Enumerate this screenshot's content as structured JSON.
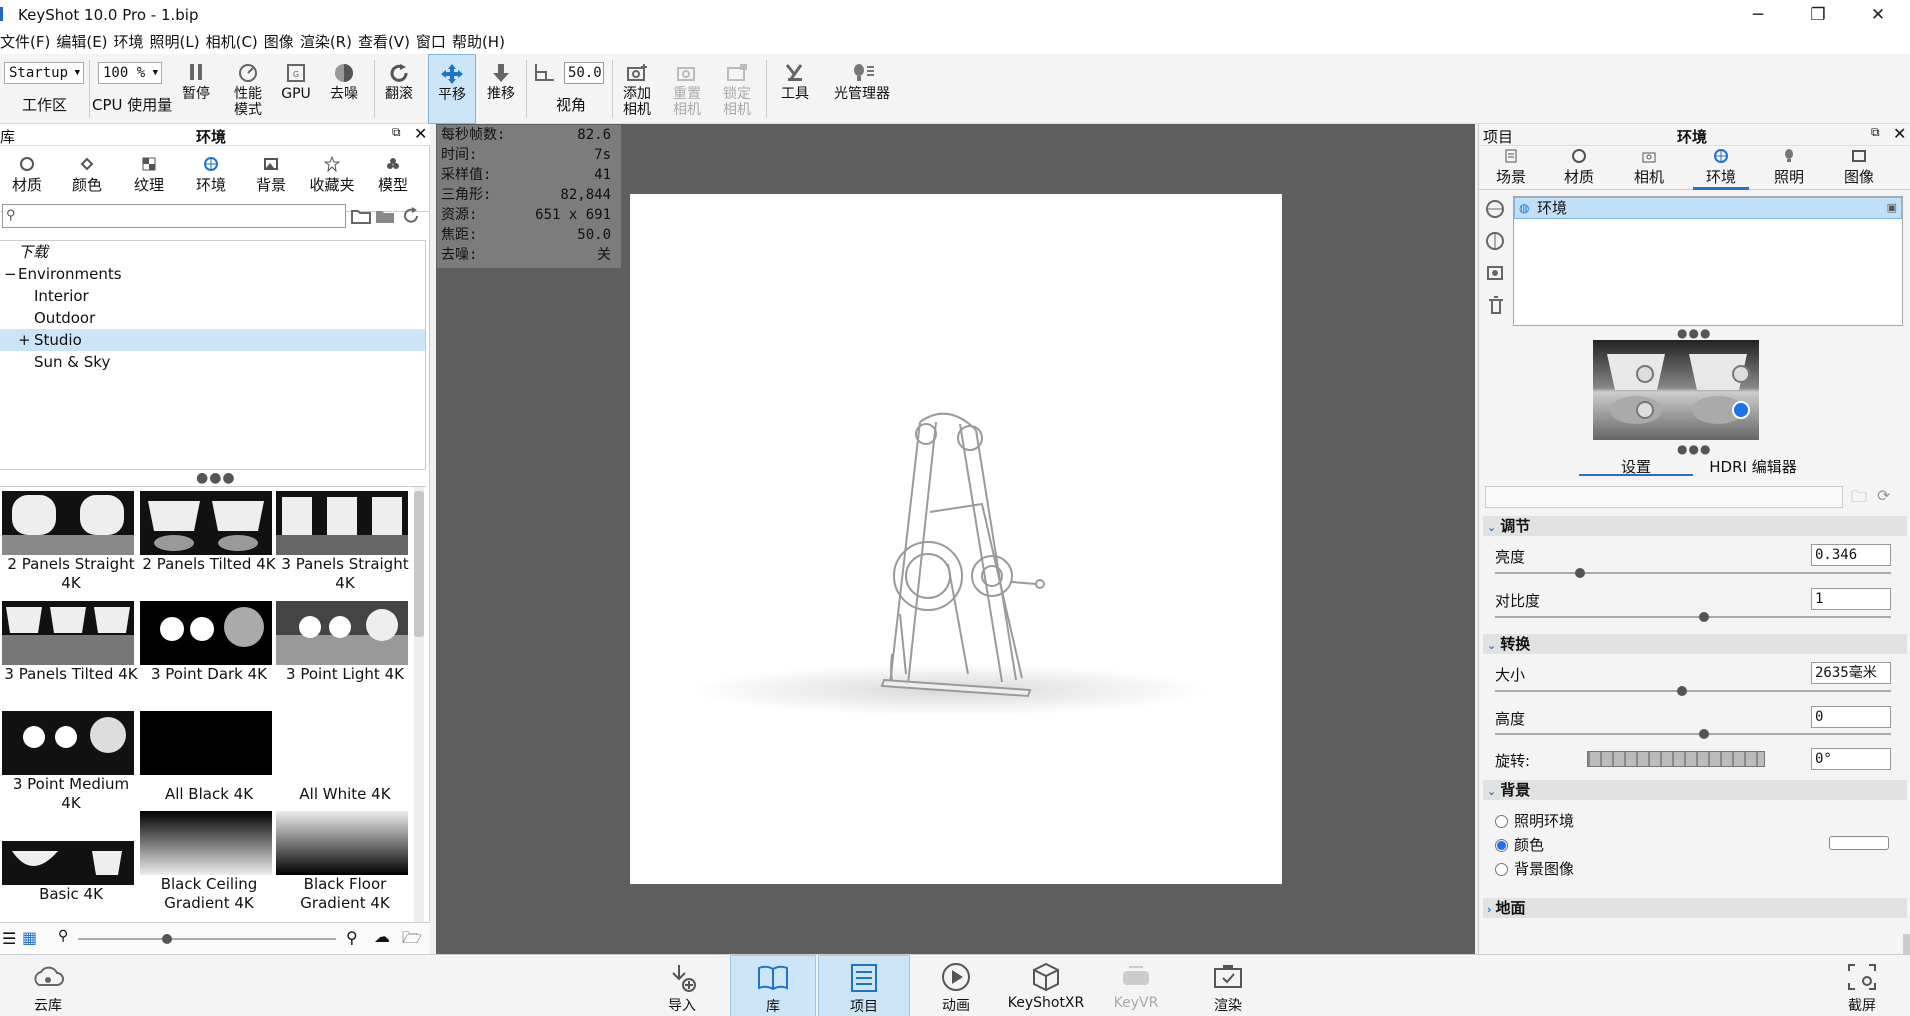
{
  "window": {
    "title": "KeyShot 10.0 Pro  - 1.bip",
    "minimize": "─",
    "maximize": "❐",
    "close": "✕"
  },
  "menu": [
    "文件(F)",
    "编辑(E)",
    "环境",
    "照明(L)",
    "相机(C)",
    "图像",
    "渲染(R)",
    "查看(V)",
    "窗口",
    "帮助(H)"
  ],
  "toolbar": {
    "workspace_value": "Startup",
    "workspace_label": "工作区",
    "cpu_value": "100 %",
    "cpu_label": "CPU 使用量",
    "pause": "暂停",
    "perf_mode": "性能\n模式",
    "gpu": "GPU",
    "denoise": "去噪",
    "tumble": "翻滚",
    "pan": "平移",
    "dolly": "推移",
    "fov_value": "50.0",
    "fov_label": "视角",
    "add_camera": "添加\n相机",
    "reset_camera": "重置\n相机",
    "lock_camera": "锁定\n相机",
    "tools": "工具",
    "light_manager": "光管理器"
  },
  "library": {
    "header": "库",
    "title": "环境",
    "tabs": [
      "材质",
      "颜色",
      "纹理",
      "环境",
      "背景",
      "收藏夹",
      "模型"
    ],
    "active_tab": "环境",
    "search_placeholder": "",
    "tree": {
      "download": "下载",
      "environments": "Environments",
      "items": [
        "Interior",
        "Outdoor",
        "Studio",
        "Sun & Sky"
      ],
      "selected": "Studio"
    },
    "thumbnails": [
      {
        "label": "2 Panels Straight 4K"
      },
      {
        "label": "2 Panels Tilted 4K"
      },
      {
        "label": "3 Panels Straight 4K"
      },
      {
        "label": "3 Panels Tilted 4K"
      },
      {
        "label": "3 Point Dark 4K"
      },
      {
        "label": "3 Point Light 4K"
      },
      {
        "label": "3 Point Medium 4K"
      },
      {
        "label": "All Black 4K"
      },
      {
        "label": "All White 4K"
      },
      {
        "label": "Basic 4K"
      },
      {
        "label": "Black Ceiling Gradient 4K"
      },
      {
        "label": "Black Floor Gradient 4K"
      }
    ],
    "cloud_label": "云库"
  },
  "hud": [
    {
      "k": "每秒帧数:",
      "v": "82.6"
    },
    {
      "k": "时间:",
      "v": "7s"
    },
    {
      "k": "采样值:",
      "v": "41"
    },
    {
      "k": "三角形:",
      "v": "82,844"
    },
    {
      "k": "资源:",
      "v": "651 x 691"
    },
    {
      "k": "焦距:",
      "v": "50.0"
    },
    {
      "k": "去噪:",
      "v": "关"
    }
  ],
  "project": {
    "header": "项目",
    "title": "环境",
    "tabs": [
      "场景",
      "材质",
      "相机",
      "环境",
      "照明",
      "图像"
    ],
    "active_tab": "环境",
    "env_item": "环境",
    "subtabs": [
      "设置",
      "HDRI 编辑器"
    ],
    "adjust": {
      "title": "调节",
      "brightness_label": "亮度",
      "brightness": "0.346",
      "contrast_label": "对比度",
      "contrast": "1"
    },
    "transform": {
      "title": "转换",
      "size_label": "大小",
      "size": "2635毫米",
      "height_label": "高度",
      "height": "0",
      "rotation_label": "旋转:",
      "rotation": "0°"
    },
    "background": {
      "title": "背景",
      "options": [
        "照明环境",
        "颜色",
        "背景图像"
      ],
      "selected": "颜色"
    },
    "ground_title": "地面"
  },
  "bottom": {
    "import": "导入",
    "library": "库",
    "project": "项目",
    "animation": "动画",
    "keyshotxr": "KeyShotXR",
    "keyvr": "KeyVR",
    "render": "渲染",
    "screenshot": "截屏"
  }
}
